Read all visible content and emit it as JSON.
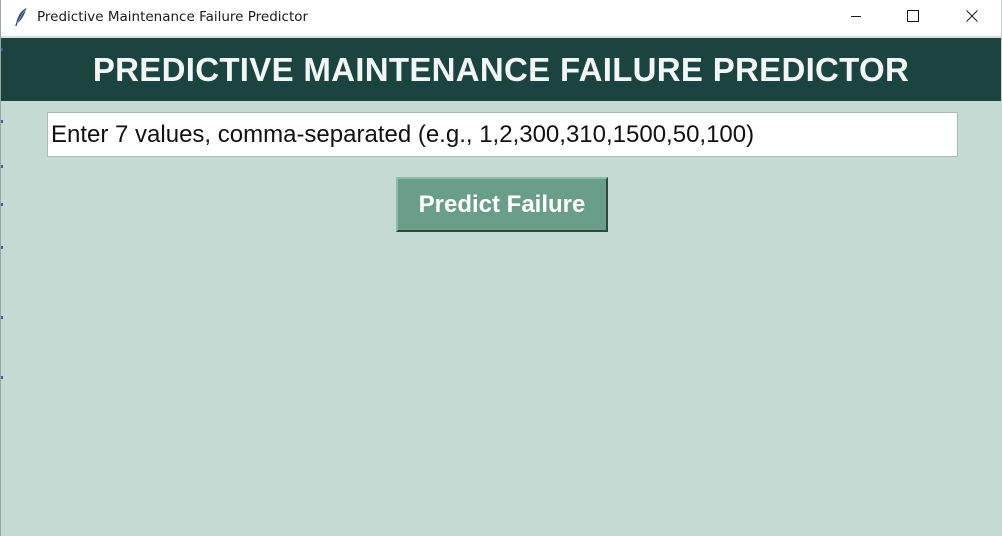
{
  "window": {
    "title": "Predictive Maintenance Failure Predictor",
    "app_icon": "feather-icon",
    "controls": {
      "minimize": "minimize-icon",
      "maximize": "maximize-icon",
      "close": "close-icon"
    }
  },
  "header": {
    "title": "PREDICTIVE MAINTENANCE FAILURE PREDICTOR"
  },
  "input": {
    "value": "Enter 7 values, comma-separated (e.g., 1,2,300,310,1500,50,100)"
  },
  "actions": {
    "predict_label": "Predict Failure"
  },
  "colors": {
    "background": "#c4dad3",
    "header_bg": "#1b4440",
    "header_text": "#f2f6f5",
    "button_bg": "#6a9e8b",
    "button_text": "#ffffff"
  }
}
